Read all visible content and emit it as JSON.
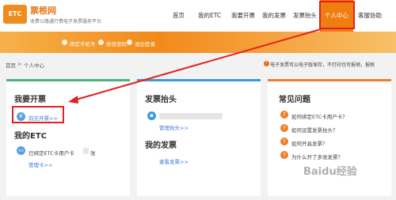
{
  "header": {
    "logo_text": "ETC",
    "brand": "票根网",
    "subtitle": "收费公路通行费电子发票服务平台",
    "nav": [
      "首页",
      "我的ETC",
      "我要开票",
      "我的发票",
      "发票抬头",
      "个人中心",
      "客服协助"
    ],
    "accent_color": "#ef7d10"
  },
  "banner": {
    "items": [
      "绑定手机号",
      "修改密码",
      "退出登录"
    ]
  },
  "breadcrumb": {
    "home": "首页",
    "separator": ">",
    "current": "个人中心"
  },
  "notice": "电子发票可以电子版保存，不打印也可报销，报税",
  "cards": {
    "invoice": {
      "title": "我要开票",
      "go_link": "前去开票>>",
      "etc_title": "我的ETC",
      "bound_text": "已绑定ETC卡用户卡",
      "bound_count_unit": "张",
      "manage_link": "管理卡>>"
    },
    "header_card": {
      "title": "发票抬头",
      "manage_link": "管理抬头>>",
      "my_invoices_title": "我的发票",
      "view_link": "查看发票>>"
    },
    "faq": {
      "title": "常见问题",
      "items": [
        "如何绑定ETC卡用户卡？",
        "如何设置发票抬头？",
        "如何开具发票？",
        "为什么开了多张发票？"
      ]
    }
  },
  "watermark": "Baidu经验"
}
